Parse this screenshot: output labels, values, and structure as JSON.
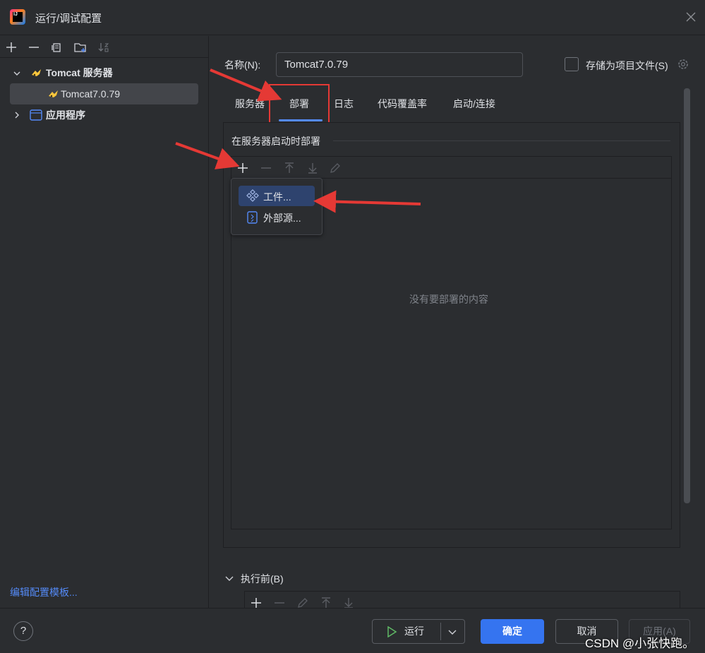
{
  "window": {
    "title": "运行/调试配置"
  },
  "tree": {
    "items": [
      {
        "label": "Tomcat 服务器",
        "icon": "tomcat-icon",
        "expanded": true
      },
      {
        "label": "Tomcat7.0.79",
        "icon": "tomcat-icon",
        "selected": true
      },
      {
        "label": "应用程序",
        "icon": "application-icon",
        "expanded": false
      }
    ],
    "edit_templates": "编辑配置模板..."
  },
  "form": {
    "name_label": "名称(N):",
    "name_value": "Tomcat7.0.79",
    "store_label": "存储为项目文件(S)",
    "store_checked": false
  },
  "tabs": [
    "服务器",
    "部署",
    "日志",
    "代码覆盖率",
    "启动/连接"
  ],
  "active_tab": "部署",
  "deploy": {
    "heading": "在服务器启动时部署",
    "empty_text": "没有要部署的内容",
    "menu": [
      {
        "label": "工件...",
        "icon": "artifact-icon",
        "highlighted": true
      },
      {
        "label": "外部源...",
        "icon": "external-source-icon",
        "highlighted": false
      }
    ]
  },
  "before_launch": {
    "label": "执行前(B)"
  },
  "footer": {
    "help": "?",
    "run": "运行",
    "ok": "确定",
    "cancel": "取消",
    "apply": "应用(A)"
  },
  "watermark": "CSDN @小张快跑。",
  "colors": {
    "accent": "#3574f0",
    "link": "#548af7",
    "highlight_border": "#e53935",
    "arrow": "#e53935"
  }
}
